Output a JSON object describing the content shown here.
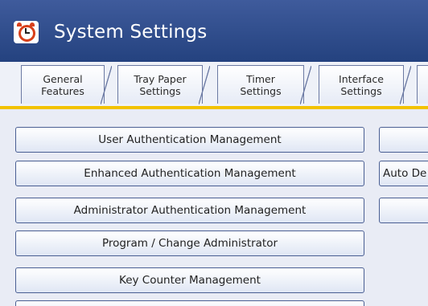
{
  "title": "System Settings",
  "tabs": [
    {
      "line1": "General",
      "line2": "Features"
    },
    {
      "line1": "Tray Paper",
      "line2": "Settings"
    },
    {
      "line1": "Timer",
      "line2": "Settings"
    },
    {
      "line1": "Interface",
      "line2": "Settings"
    },
    {
      "line1": "",
      "line2": ""
    }
  ],
  "left_buttons": [
    "User Authentication Management",
    "Enhanced Authentication Management",
    "Administrator Authentication Management",
    "Program / Change Administrator",
    "Key Counter Management"
  ],
  "right_buttons": [
    "",
    "Auto De",
    ""
  ],
  "colors": {
    "titlebar": "#2f4d8d",
    "tab_underline": "#f2c200",
    "button_border": "#4a5f93"
  },
  "icons": {
    "title_icon": "alarm-clock-icon"
  }
}
